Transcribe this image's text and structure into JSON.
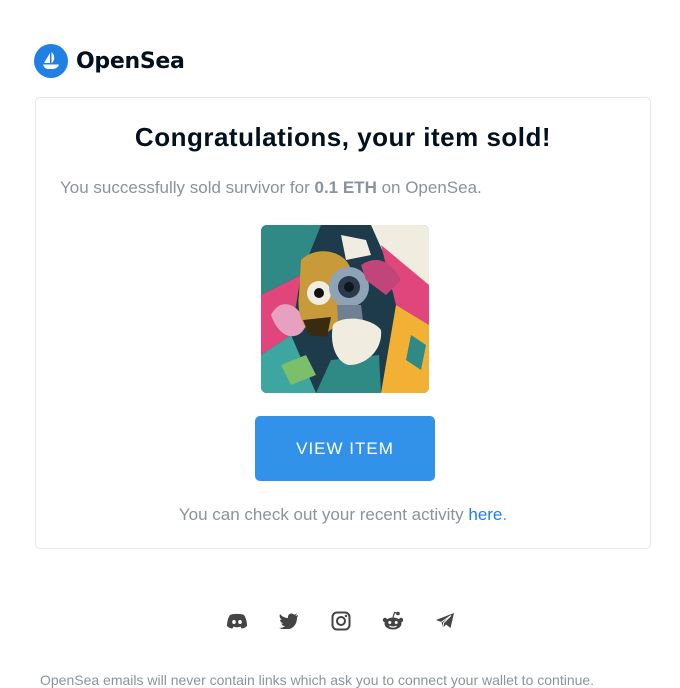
{
  "brand": {
    "name": "OpenSea",
    "logo_icon": "opensea-logo-icon",
    "color": "#2081e2"
  },
  "card": {
    "title": "Congratulations, your item sold!",
    "sold_prefix": "You successfully sold survivor for ",
    "price": "0.1 ETH",
    "sold_suffix": " on OpenSea.",
    "item_image_alt": "survivor artwork",
    "view_button_label": "VIEW ITEM",
    "activity_prefix": "You can check out your recent activity ",
    "activity_link": "here",
    "activity_suffix": "."
  },
  "socials": [
    {
      "name": "discord-icon"
    },
    {
      "name": "twitter-icon"
    },
    {
      "name": "instagram-icon"
    },
    {
      "name": "reddit-icon"
    },
    {
      "name": "telegram-icon"
    }
  ],
  "footer": {
    "disclaimer": "OpenSea emails will never contain links which ask you to connect your wallet to continue."
  },
  "colors": {
    "accent": "#3291e9",
    "muted_text": "#8a939b",
    "heading": "#04111d"
  }
}
